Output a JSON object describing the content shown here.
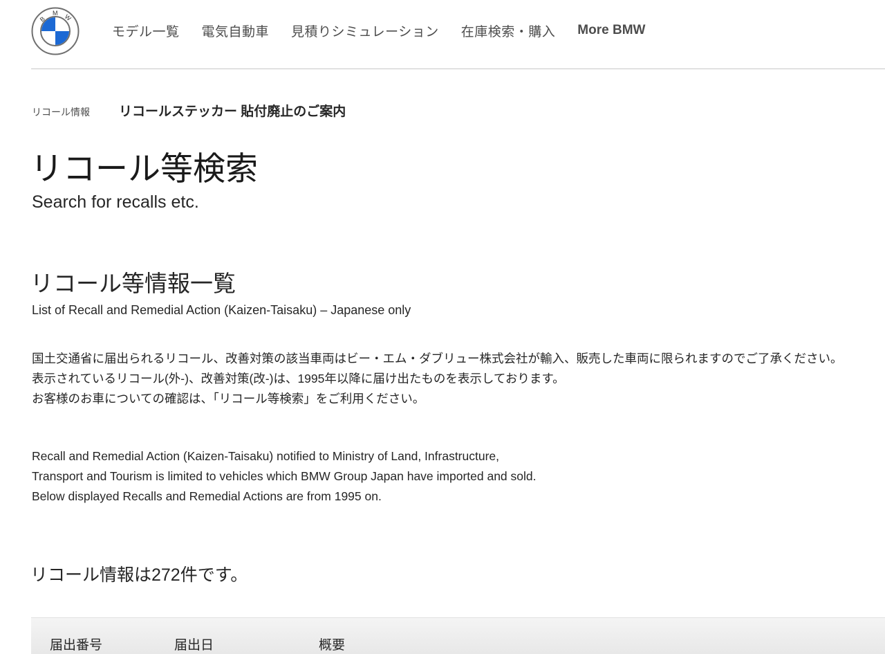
{
  "header": {
    "logo": {
      "letters": [
        "B",
        "M",
        "W"
      ],
      "icon": "bmw-roundel-icon",
      "colors": {
        "blue": "#1c69d4",
        "ring": "#6f6f6f"
      }
    },
    "nav": [
      {
        "label": "モデル一覧"
      },
      {
        "label": "電気自動車"
      },
      {
        "label": "見積りシミュレーション"
      },
      {
        "label": "在庫検索・購入"
      },
      {
        "label": "More BMW"
      }
    ]
  },
  "breadcrumb": {
    "parent": "リコール情報",
    "current": "リコールステッカー 貼付廃止のご案内"
  },
  "main": {
    "title": "リコール等検索",
    "subtitle": "Search for recalls etc.",
    "section_title": "リコール等情報一覧",
    "section_subtitle": "List of Recall and Remedial Action (Kaizen-Taisaku) – Japanese only",
    "paragraph_jp": [
      "国土交通省に届出られるリコール、改善対策の該当車両はビー・エム・ダブリュー株式会社が輸入、販売した車両に限られますのでご了承ください。",
      "表示されているリコール(外-)、改善対策(改-)は、1995年以降に届け出たものを表示しております。",
      "お客様のお車についての確認は、「リコール等検索」をご利用ください。"
    ],
    "paragraph_en": [
      "Recall and Remedial Action (Kaizen-Taisaku) notified to Ministry of Land, Infrastructure,",
      "Transport and Tourism is limited to vehicles which BMW Group Japan have imported and sold.",
      "Below displayed Recalls and Remedial Actions are from 1995 on."
    ],
    "count_text": "リコール情報は272件です。"
  },
  "table": {
    "headers": [
      "届出番号",
      "届出日",
      "概要"
    ]
  }
}
